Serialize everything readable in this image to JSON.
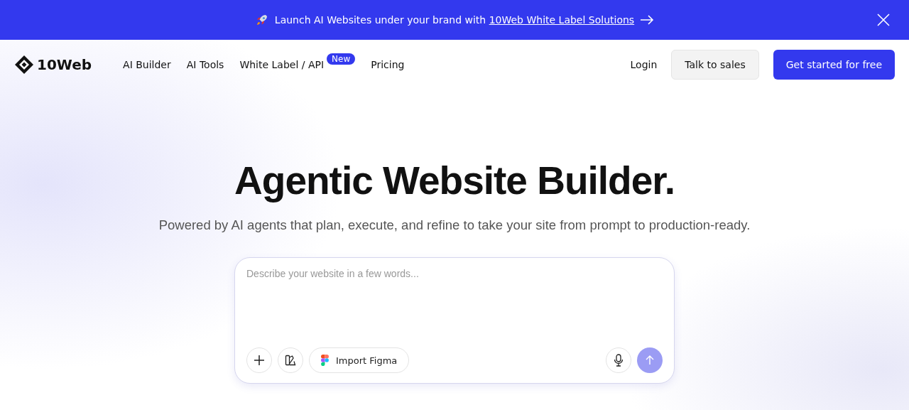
{
  "banner": {
    "text": "Launch AI Websites under your brand with",
    "link": "10Web White Label Solutions"
  },
  "nav": {
    "logo": "10Web",
    "items": [
      {
        "label": "AI Builder"
      },
      {
        "label": "AI Tools"
      },
      {
        "label": "White Label / API",
        "badge": "New"
      },
      {
        "label": "Pricing"
      }
    ],
    "login": "Login",
    "sales": "Talk to sales",
    "cta": "Get started for free"
  },
  "hero": {
    "title": "Agentic Website Builder.",
    "subtitle": "Powered by AI agents that plan, execute, and refine to take your site from prompt to production-ready."
  },
  "prompt": {
    "placeholder": "Describe your website in a few words...",
    "import": "Import Figma",
    "send_disabled": true
  }
}
